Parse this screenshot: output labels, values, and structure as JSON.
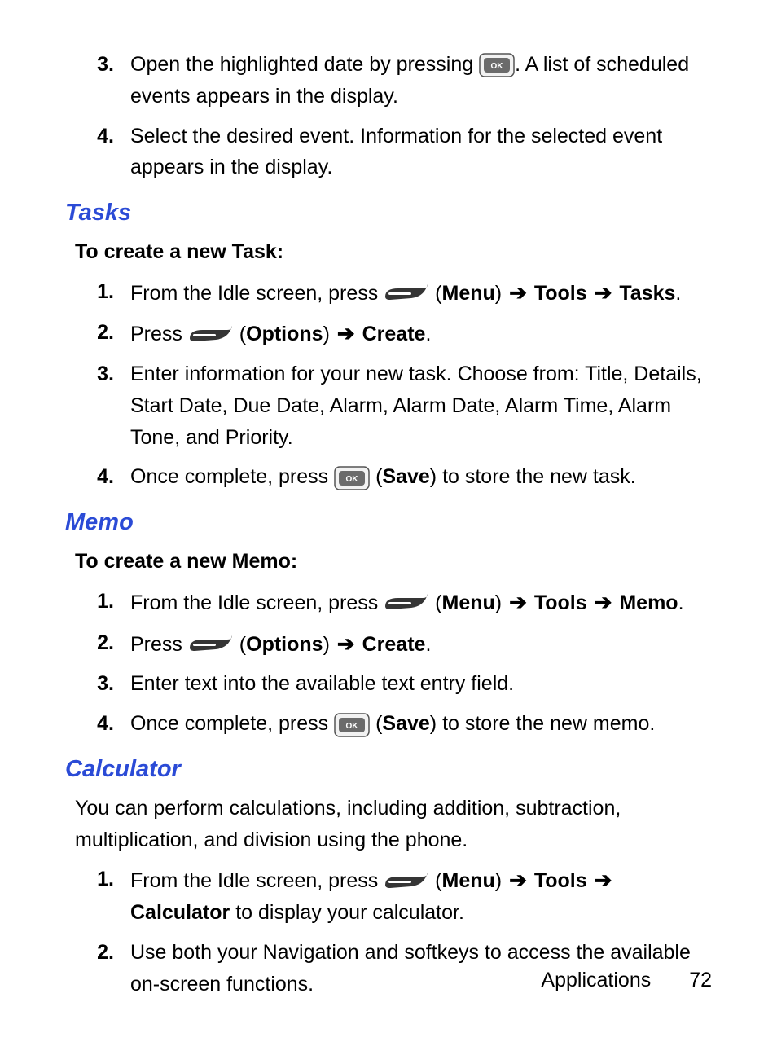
{
  "icons": {
    "ok_label": "OK"
  },
  "top_steps": [
    {
      "num": "3.",
      "segments": [
        {
          "t": "text",
          "v": "Open the highlighted date by pressing "
        },
        {
          "t": "ok"
        },
        {
          "t": "text",
          "v": ". A list of scheduled events appears in the display."
        }
      ]
    },
    {
      "num": "4.",
      "segments": [
        {
          "t": "text",
          "v": "Select the desired event. Information for the selected event appears in the display."
        }
      ]
    }
  ],
  "tasks": {
    "heading": "Tasks",
    "sub": "To create a new Task:",
    "steps": [
      {
        "num": "1.",
        "segments": [
          {
            "t": "text",
            "v": "From the Idle screen, press "
          },
          {
            "t": "soft"
          },
          {
            "t": "text",
            "v": " ("
          },
          {
            "t": "bold",
            "v": "Menu"
          },
          {
            "t": "text",
            "v": ") "
          },
          {
            "t": "arrow"
          },
          {
            "t": "text",
            "v": " "
          },
          {
            "t": "bold",
            "v": "Tools"
          },
          {
            "t": "text",
            "v": " "
          },
          {
            "t": "arrow"
          },
          {
            "t": "text",
            "v": " "
          },
          {
            "t": "bold",
            "v": "Tasks"
          },
          {
            "t": "text",
            "v": "."
          }
        ]
      },
      {
        "num": "2.",
        "segments": [
          {
            "t": "text",
            "v": "Press "
          },
          {
            "t": "soft"
          },
          {
            "t": "text",
            "v": " ("
          },
          {
            "t": "bold",
            "v": "Options"
          },
          {
            "t": "text",
            "v": ") "
          },
          {
            "t": "arrow"
          },
          {
            "t": "text",
            "v": " "
          },
          {
            "t": "bold",
            "v": "Create"
          },
          {
            "t": "text",
            "v": "."
          }
        ]
      },
      {
        "num": "3.",
        "segments": [
          {
            "t": "text",
            "v": "Enter information for your new task. Choose from: Title, Details, Start Date, Due Date, Alarm, Alarm Date, Alarm Time, Alarm Tone, and Priority."
          }
        ]
      },
      {
        "num": "4.",
        "segments": [
          {
            "t": "text",
            "v": "Once complete, press "
          },
          {
            "t": "ok"
          },
          {
            "t": "text",
            "v": " ("
          },
          {
            "t": "bold",
            "v": "Save"
          },
          {
            "t": "text",
            "v": ") to store the new task."
          }
        ]
      }
    ]
  },
  "memo": {
    "heading": "Memo",
    "sub": "To create a new Memo:",
    "steps": [
      {
        "num": "1.",
        "segments": [
          {
            "t": "text",
            "v": "From the Idle screen, press "
          },
          {
            "t": "soft"
          },
          {
            "t": "text",
            "v": " ("
          },
          {
            "t": "bold",
            "v": "Menu"
          },
          {
            "t": "text",
            "v": ") "
          },
          {
            "t": "arrow"
          },
          {
            "t": "text",
            "v": " "
          },
          {
            "t": "bold",
            "v": "Tools"
          },
          {
            "t": "text",
            "v": " "
          },
          {
            "t": "arrow"
          },
          {
            "t": "text",
            "v": " "
          },
          {
            "t": "bold",
            "v": "Memo"
          },
          {
            "t": "text",
            "v": "."
          }
        ]
      },
      {
        "num": "2.",
        "segments": [
          {
            "t": "text",
            "v": "Press "
          },
          {
            "t": "soft"
          },
          {
            "t": "text",
            "v": " ("
          },
          {
            "t": "bold",
            "v": "Options"
          },
          {
            "t": "text",
            "v": ") "
          },
          {
            "t": "arrow"
          },
          {
            "t": "text",
            "v": " "
          },
          {
            "t": "bold",
            "v": "Create"
          },
          {
            "t": "text",
            "v": "."
          }
        ]
      },
      {
        "num": "3.",
        "segments": [
          {
            "t": "text",
            "v": "Enter text into the available text entry field."
          }
        ]
      },
      {
        "num": "4.",
        "segments": [
          {
            "t": "text",
            "v": "Once complete, press "
          },
          {
            "t": "ok"
          },
          {
            "t": "text",
            "v": " ("
          },
          {
            "t": "bold",
            "v": "Save"
          },
          {
            "t": "text",
            "v": ") to store the new memo."
          }
        ]
      }
    ]
  },
  "calculator": {
    "heading": "Calculator",
    "intro": "You can perform calculations, including addition, subtraction, multiplication, and division using the phone.",
    "steps": [
      {
        "num": "1.",
        "segments": [
          {
            "t": "text",
            "v": "From the Idle screen, press "
          },
          {
            "t": "soft"
          },
          {
            "t": "text",
            "v": " ("
          },
          {
            "t": "bold",
            "v": "Menu"
          },
          {
            "t": "text",
            "v": ") "
          },
          {
            "t": "arrow"
          },
          {
            "t": "text",
            "v": " "
          },
          {
            "t": "bold",
            "v": "Tools"
          },
          {
            "t": "text",
            "v": " "
          },
          {
            "t": "arrow"
          },
          {
            "t": "text",
            "v": " "
          },
          {
            "t": "bold",
            "v": "Calculator"
          },
          {
            "t": "text",
            "v": " to display your calculator."
          }
        ]
      },
      {
        "num": "2.",
        "segments": [
          {
            "t": "text",
            "v": "Use both your Navigation and softkeys to access the available on-screen functions."
          }
        ]
      }
    ]
  },
  "footer": {
    "section": "Applications",
    "page": "72"
  }
}
